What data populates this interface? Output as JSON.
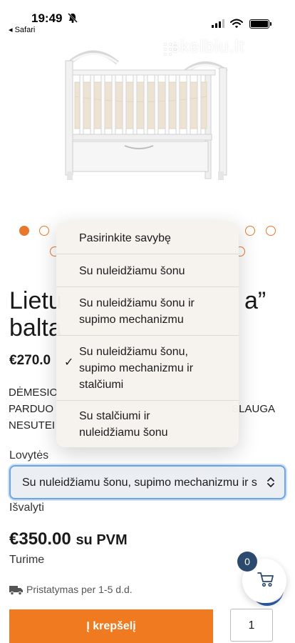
{
  "status_bar": {
    "time": "19:49",
    "back_label": "◂ Safari"
  },
  "watermark": "skelbiu.lt",
  "carousel": {
    "dot_count": 6,
    "active_index": 0
  },
  "product": {
    "title_line1": "Lietu",
    "title_line1_end": "a”",
    "title_line2": "balta",
    "price_small": "€270.0",
    "notice_line1": "DĖMESIO",
    "notice_line2": "PARDUO",
    "notice_line2_end": "SLAUGA",
    "notice_line3": "NESUTEI"
  },
  "option_field": {
    "label": "Lovytės",
    "selected_value": "Su nuleidžiamu šonu, supimo mechanizmu ir stalčiumi",
    "clear_label": "Išvalyti"
  },
  "dropdown": {
    "options": [
      {
        "label": "Pasirinkite savybę",
        "selected": false
      },
      {
        "label": "Su nuleidžiamu šonu",
        "selected": false
      },
      {
        "label": "Su nuleidžiamu šonu ir supimo mechanizmu",
        "selected": false
      },
      {
        "label": "Su nuleidžiamu šonu, supimo mechanizmu ir stalčiumi",
        "selected": true
      },
      {
        "label": "Su stalčiumi ir nuleidžiamu šonu",
        "selected": false
      }
    ],
    "check_mark": "✓"
  },
  "pricing": {
    "amount": "€350.00",
    "vat_label": "su PVM",
    "stock": "Turime",
    "delivery": "Pristatymas per 1-5 d.d."
  },
  "cart": {
    "add_label": "Į krepšelį",
    "quantity": "1",
    "badge_count": "0"
  },
  "colors": {
    "accent": "#f07a1f",
    "dot": "#e8782b",
    "badge": "#2c4a6e",
    "focus": "#6aa6e6"
  }
}
